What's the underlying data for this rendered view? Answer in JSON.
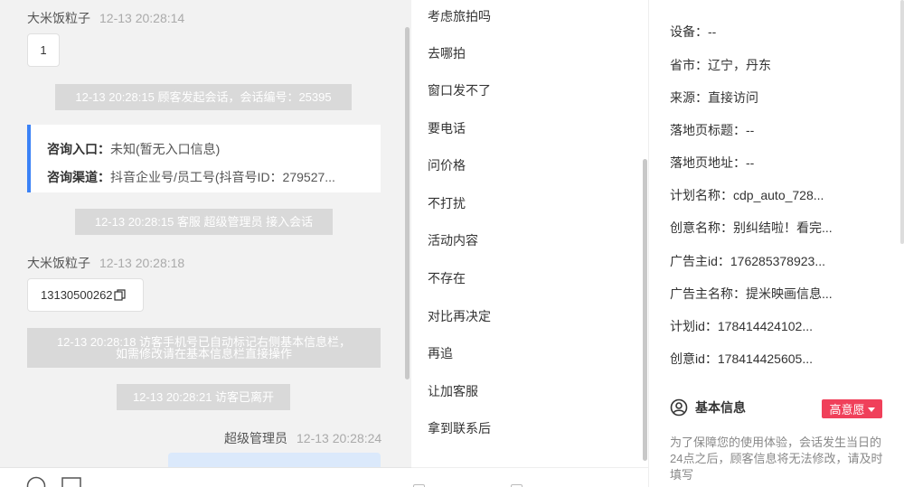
{
  "chat": {
    "msg1": {
      "sender": "大米饭粒子",
      "time": "12-13 20:28:14",
      "text": "1"
    },
    "sys1": "12-13 20:28:15 顾客发起会话，会话编号：25395",
    "card": {
      "entry_label": "咨询入口：",
      "entry_value": "未知(暂无入口信息)",
      "channel_label": "咨询渠道：",
      "channel_value": "抖音企业号/员工号(抖音号ID：279527..."
    },
    "sys2": "12-13 20:28:15 客服 超级管理员 接入会话",
    "msg2": {
      "sender": "大米饭粒子",
      "time": "12-13 20:28:18",
      "text": "13130500262"
    },
    "sys3_line1": "12-13 20:28:18 访客手机号已自动标记右侧基本信息栏，",
    "sys3_line2": "如需修改请在基本信息栏直接操作",
    "sys4": "12-13 20:28:21 访客已离开",
    "agent": {
      "sender": "超级管理员",
      "time": "12-13 20:28:24"
    }
  },
  "quick_replies": [
    "考虑旅拍吗",
    "去哪拍",
    "窗口发不了",
    "要电话",
    "问价格",
    "不打扰",
    "活动内容",
    "不存在",
    "对比再决定",
    "再追",
    "让加客服",
    "拿到联系后"
  ],
  "info": {
    "rows": [
      "设备：--",
      "省市：辽宁，丹东",
      "来源：直接访问",
      "落地页标题：--",
      "落地页地址：--",
      "计划名称：cdp_auto_728...",
      "创意名称：别纠结啦！看完...",
      "广告主id：176285378923...",
      "广告主名称：提米映画信息...",
      "计划id：178414424102...",
      "创意id：178414425605..."
    ],
    "section_title": "基本信息",
    "badge": "高意愿",
    "note": "为了保障您的使用体验，会话发生当日的24点之后，顾客信息将无法修改，请及时填写"
  },
  "colors": {
    "accent": "#3b82f6",
    "badge": "#f0405a"
  }
}
